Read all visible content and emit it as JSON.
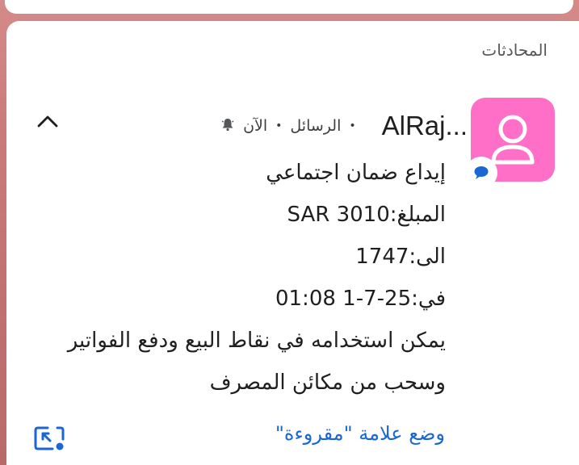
{
  "section": {
    "label": "المحادثات"
  },
  "notification": {
    "sender": "AlRaj...",
    "app": "الرسائل",
    "time": "الآن",
    "lines": [
      "إيداع ضمان اجتماعي",
      "المبلغ:SAR 3010",
      "الى:1747",
      "في:25-7-1 01:08",
      "يمكن استخدامه في نقاط البيع ودفع الفواتير",
      "وسحب من مكائن المصرف"
    ],
    "action_label": "وضع علامة \"مقروءة\""
  },
  "icons": {
    "avatar": "person-icon",
    "app_badge": "chat-bubble-icon",
    "alert": "bell-icon",
    "expand": "chevron-up-icon",
    "pip": "picture-in-picture-icon"
  },
  "colors": {
    "avatar_bg": "#ff6ec7",
    "link": "#1a66d3",
    "badge": "#1a66d3"
  }
}
